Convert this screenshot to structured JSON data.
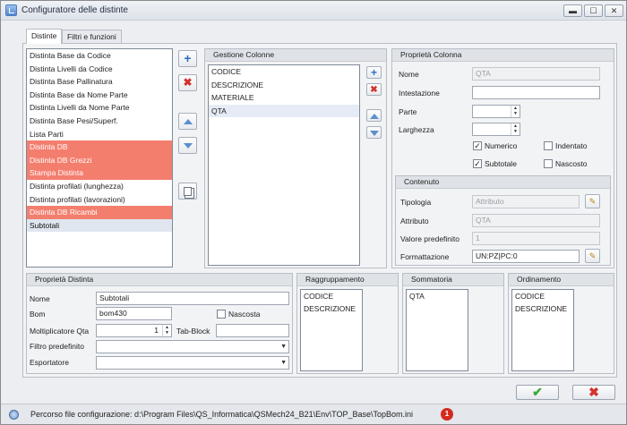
{
  "window": {
    "title": "Configuratore delle distinte",
    "btn_min": "▬",
    "btn_max": "☐",
    "btn_close": "✕"
  },
  "tabs": [
    {
      "label": "Distinte"
    },
    {
      "label": "Filtri e funzioni"
    }
  ],
  "distinte": {
    "items": [
      {
        "label": "Distinta Base da Codice"
      },
      {
        "label": "Distinta Livelli da Codice"
      },
      {
        "label": "Distinta Base Pallinatura"
      },
      {
        "label": "Distinta Base da Nome Parte"
      },
      {
        "label": "Distinta Livelli da Nome Parte"
      },
      {
        "label": "Distinta Base Pesi/Superf."
      },
      {
        "label": "Lista Parti"
      },
      {
        "label": "Distinta DB"
      },
      {
        "label": "Distinta DB Grezzi"
      },
      {
        "label": "Stampa Distinta"
      },
      {
        "label": "Distinta profilati (lunghezza)"
      },
      {
        "label": "Distinta profilati (lavorazioni)"
      },
      {
        "label": "Distinta DB Ricambi"
      },
      {
        "label": "Subtotali"
      }
    ],
    "highlight_color": "#f47e6e"
  },
  "gestione_colonne": {
    "title": "Gestione Colonne",
    "items": [
      {
        "label": "CODICE"
      },
      {
        "label": "DESCRIZIONE"
      },
      {
        "label": "MATERIALE"
      },
      {
        "label": "QTA"
      }
    ]
  },
  "proprieta_colonna": {
    "title": "Proprietà Colonna",
    "nome_label": "Nome",
    "nome_value": "QTA",
    "intestazione_label": "Intestazione",
    "intestazione_value": "",
    "parte_label": "Parte",
    "parte_value": "",
    "larghezza_label": "Larghezza",
    "larghezza_value": "",
    "numerico_label": "Numerico",
    "numerico_checked": true,
    "indentato_label": "Indentato",
    "indentato_checked": false,
    "subtotale_label": "Subtotale",
    "subtotale_checked": true,
    "nascosto_label": "Nascosto",
    "nascosto_checked": false
  },
  "contenuto": {
    "title": "Contenuto",
    "tipologia_label": "Tipologia",
    "tipologia_value": "Attributo",
    "attributo_label": "Attributo",
    "attributo_value": "QTA",
    "valore_label": "Valore predefinito",
    "valore_value": "1",
    "formattazione_label": "Formattazione",
    "formattazione_value": "UN:PZ|PC:0"
  },
  "proprieta_distinta": {
    "title": "Proprietà Distinta",
    "nome_label": "Nome",
    "nome_value": "Subtotali",
    "bom_label": "Bom",
    "bom_value": "bom430",
    "nascosta_label": "Nascosta",
    "nascosta_checked": false,
    "moltiplicatore_label": "Moltiplicatore Qta",
    "moltiplicatore_value": "1",
    "tabblock_label": "Tab-Block",
    "tabblock_value": "",
    "filtro_label": "Filtro predefinito",
    "filtro_value": "",
    "esportatore_label": "Esportatore",
    "esportatore_value": ""
  },
  "raggruppamento": {
    "title": "Raggruppamento",
    "items": [
      {
        "label": "CODICE"
      },
      {
        "label": "DESCRIZIONE"
      }
    ]
  },
  "sommatoria": {
    "title": "Sommatoria",
    "items": [
      {
        "label": "QTA"
      }
    ]
  },
  "ordinamento": {
    "title": "Ordinamento",
    "items": [
      {
        "label": "CODICE"
      },
      {
        "label": "DESCRIZIONE"
      }
    ]
  },
  "status": {
    "text": "Percorso file configurazione: d:\\Program Files\\QS_Informatica\\QSMech24_B21\\Env\\TOP_Base\\TopBom.ini",
    "badge": "1"
  },
  "colors": {
    "ok": "#3da63d",
    "cancel": "#d3322d"
  }
}
